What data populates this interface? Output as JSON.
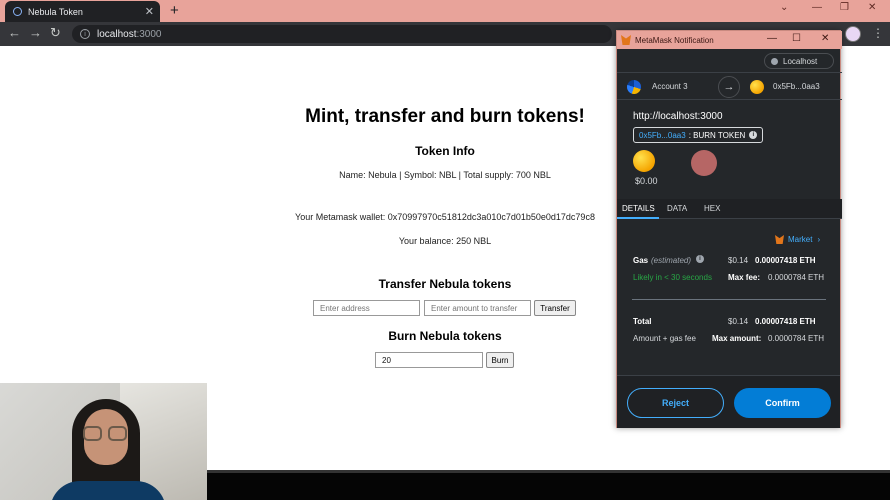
{
  "browser": {
    "tab_title": "Nebula Token",
    "new_tab": "+",
    "url_host": "localhost",
    "url_port": ":3000"
  },
  "page": {
    "heading": "Mint, transfer and burn tokens!",
    "token_info_title": "Token Info",
    "token_info": "Name: Nebula | Symbol: NBL | Total supply: 700 NBL",
    "wallet": "Your Metamask wallet: 0x70997970c51812dc3a010c7d01b50e0d17dc79c8",
    "balance": "Your balance: 250 NBL",
    "transfer_title": "Transfer Nebula tokens",
    "address_placeholder": "Enter address",
    "amount_placeholder": "Enter amount to transfer",
    "transfer_button": "Transfer",
    "burn_title": "Burn Nebula tokens",
    "burn_value": "20",
    "burn_button": "Burn"
  },
  "metamask": {
    "window_title": "MetaMask Notification",
    "network": "Localhost",
    "from_account": "Account 3",
    "to_account": "0x5Fb...0aa3",
    "origin": "http://localhost:3000",
    "method_address": "0x5Fb...0aa3",
    "method_name": ": BURN TOKEN",
    "value": "$0.00",
    "tabs": [
      "DETAILS",
      "DATA",
      "HEX"
    ],
    "market": "Market",
    "gas_label": "Gas",
    "gas_estimated": "(estimated)",
    "gas_usd": "$0.14",
    "gas_eth": "0.00007418 ETH",
    "likely": "Likely in < 30 seconds",
    "max_fee_label": "Max fee:",
    "max_fee": "0.0000784 ETH",
    "total_label": "Total",
    "total_usd": "$0.14",
    "total_eth": "0.00007418 ETH",
    "amount_gas": "Amount + gas fee",
    "max_amount_label": "Max amount:",
    "max_amount": "0.0000784 ETH",
    "reject": "Reject",
    "confirm": "Confirm"
  },
  "colors": {
    "accent": "#037dd6",
    "link": "#43aefc",
    "titlebar": "#e8a39a",
    "success": "#28a745"
  }
}
